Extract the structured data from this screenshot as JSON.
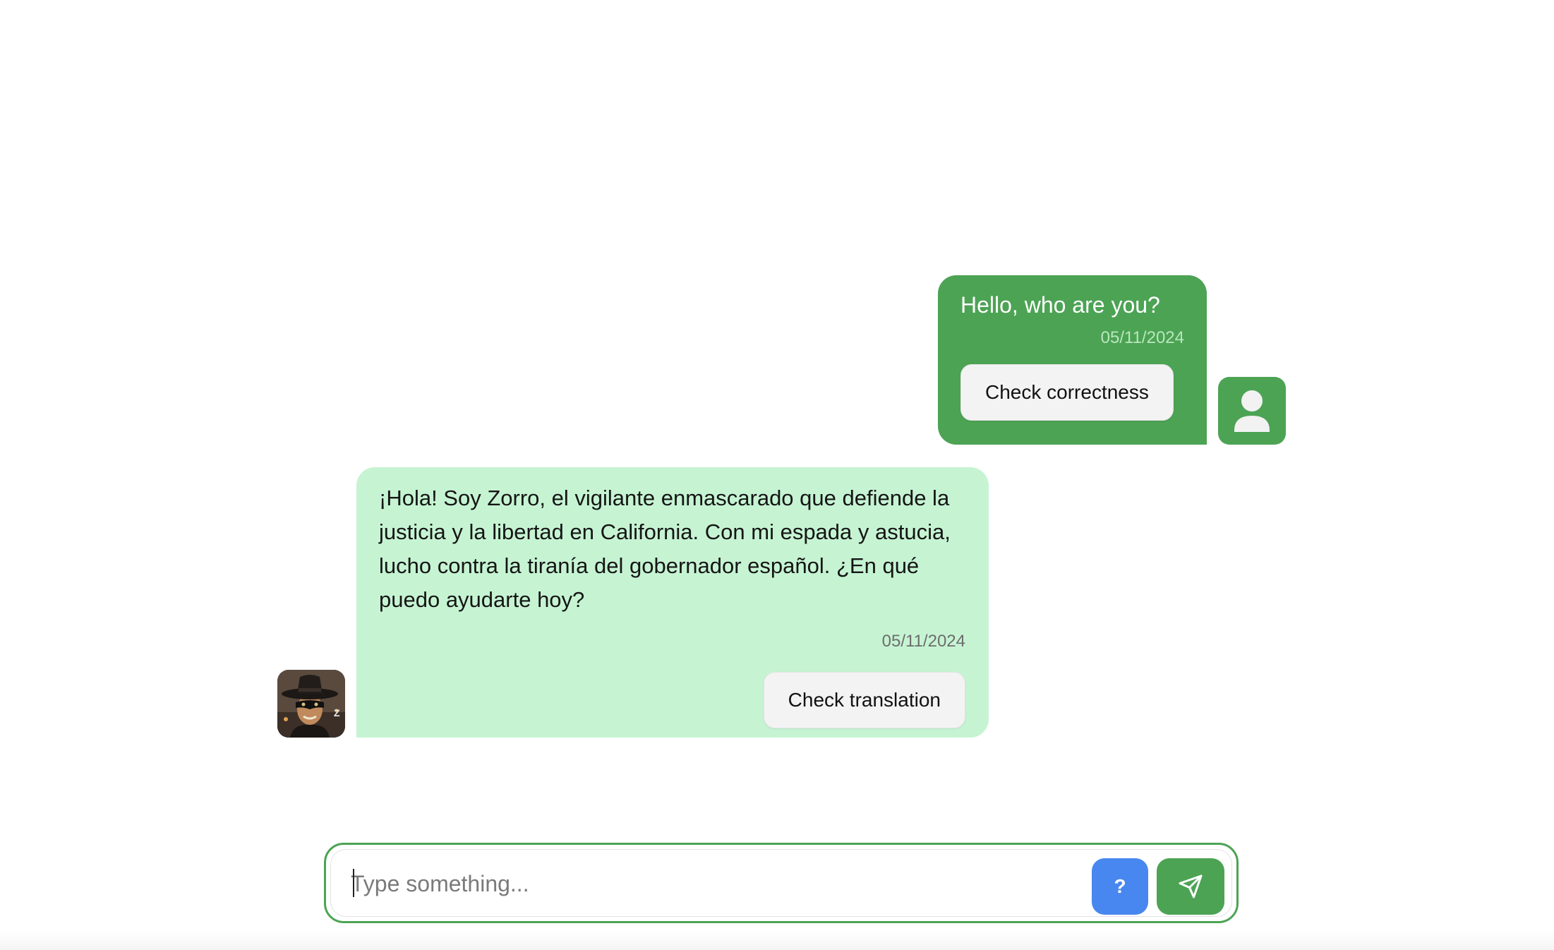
{
  "colors": {
    "accent_green": "#4ca354",
    "bot_bubble": "#c6f4d3",
    "help_blue": "#4887ef"
  },
  "messages": {
    "user": {
      "text": "Hello, who are you?",
      "date": "05/11/2024",
      "action_label": "Check correctness",
      "avatar_icon": "user-silhouette-icon"
    },
    "bot": {
      "text": "¡Hola! Soy Zorro, el vigilante enmascarado que defiende la justicia y la libertad en California. Con mi espada y astucia, lucho contra la tiranía del gobernador español. ¿En qué puedo ayudarte hoy?",
      "date": "05/11/2024",
      "action_label": "Check translation",
      "avatar_icon": "zorro-avatar"
    }
  },
  "composer": {
    "placeholder": "Type something...",
    "value": "",
    "help_label": "?",
    "send_icon": "send-icon"
  }
}
